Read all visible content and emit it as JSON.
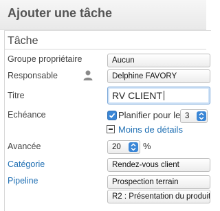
{
  "header": {
    "title": "Ajouter une tâche"
  },
  "section": {
    "title": "Tâche"
  },
  "fields": {
    "groupe": {
      "label": "Groupe propriétaire",
      "value": "Aucun"
    },
    "responsable": {
      "label": "Responsable",
      "value": "Delphine FAVORY",
      "icon": "user-icon"
    },
    "titre": {
      "label": "Titre",
      "value": "RV CLIENT"
    },
    "echeance": {
      "label": "Echéance",
      "checkbox_label": "Planifier pour le",
      "checked": true,
      "day_value": "3",
      "toggle_label": "Moins de détails"
    },
    "avancee": {
      "label": "Avancée",
      "value": "20",
      "unit": "%"
    },
    "categorie": {
      "label": "Catégorie",
      "value": "Rendez-vous client"
    },
    "pipeline": {
      "label": "Pipeline",
      "value": "Prospection terrain",
      "stage_value": "R2 : Présentation du produit"
    }
  },
  "colors": {
    "accent": "#3a86d6",
    "link": "#1f6fb3"
  }
}
